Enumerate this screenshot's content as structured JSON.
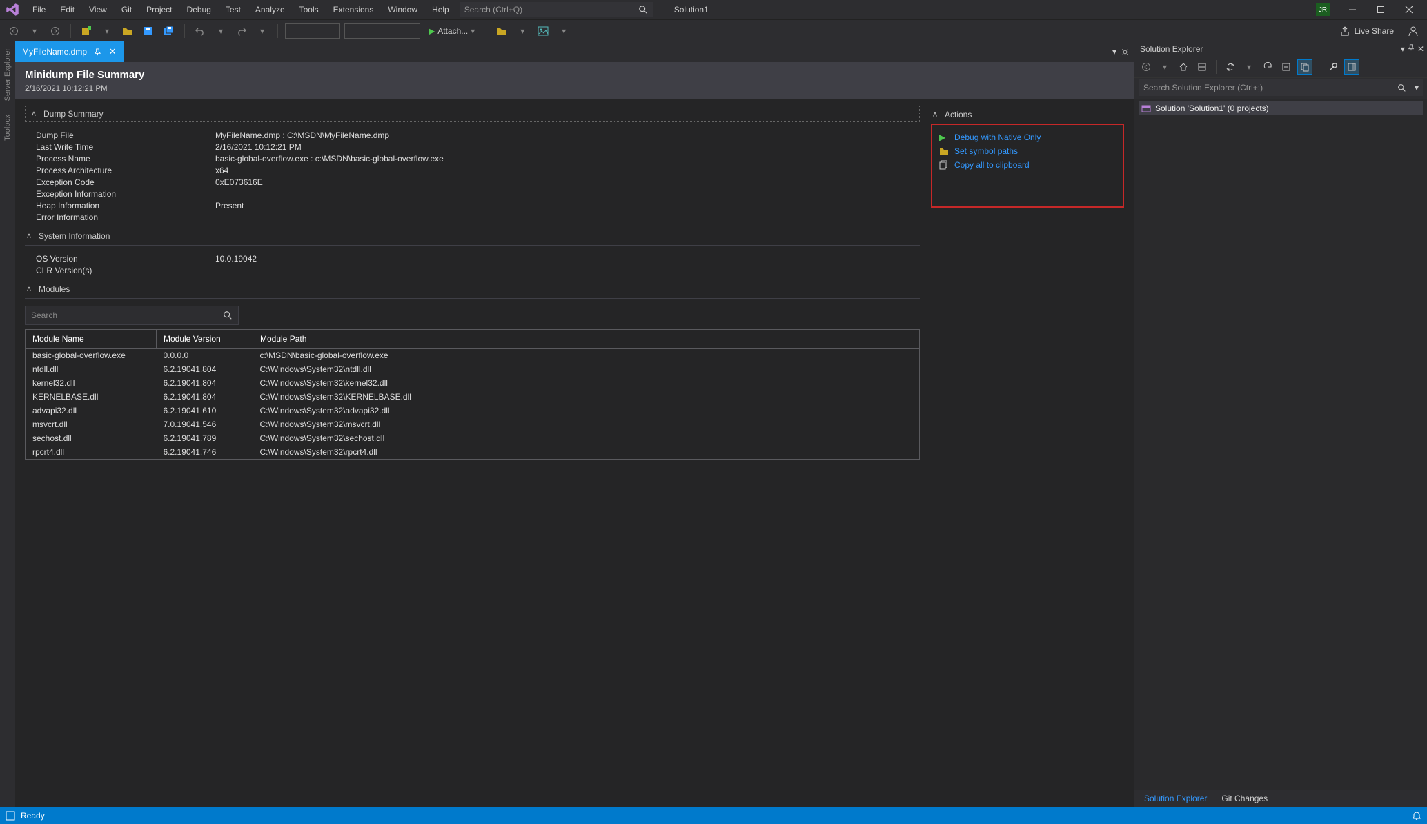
{
  "menubar": {
    "items": [
      "File",
      "Edit",
      "View",
      "Git",
      "Project",
      "Debug",
      "Test",
      "Analyze",
      "Tools",
      "Extensions",
      "Window",
      "Help"
    ],
    "search_placeholder": "Search (Ctrl+Q)",
    "solution_label": "Solution1",
    "user_initials": "JR"
  },
  "toolbar": {
    "attach_label": "Attach...",
    "liveshare_label": "Live Share"
  },
  "leftrail": {
    "tabs": [
      "Server Explorer",
      "Toolbox"
    ]
  },
  "document": {
    "tab_name": "MyFileName.dmp",
    "title": "Minidump File Summary",
    "timestamp": "2/16/2021 10:12:21 PM",
    "sections": {
      "dump_summary": {
        "header": "Dump Summary",
        "rows": [
          {
            "k": "Dump File",
            "v": "MyFileName.dmp : C:\\MSDN\\MyFileName.dmp"
          },
          {
            "k": "Last Write Time",
            "v": "2/16/2021 10:12:21 PM"
          },
          {
            "k": "Process Name",
            "v": "basic-global-overflow.exe : c:\\MSDN\\basic-global-overflow.exe"
          },
          {
            "k": "Process Architecture",
            "v": "x64"
          },
          {
            "k": "Exception Code",
            "v": "0xE073616E"
          },
          {
            "k": "Exception Information",
            "v": ""
          },
          {
            "k": "Heap Information",
            "v": "Present"
          },
          {
            "k": "Error Information",
            "v": ""
          }
        ]
      },
      "system_information": {
        "header": "System Information",
        "rows": [
          {
            "k": "OS Version",
            "v": "10.0.19042"
          },
          {
            "k": "CLR Version(s)",
            "v": ""
          }
        ]
      },
      "modules": {
        "header": "Modules",
        "search_placeholder": "Search",
        "columns": [
          "Module Name",
          "Module Version",
          "Module Path"
        ],
        "rows": [
          {
            "name": "basic-global-overflow.exe",
            "ver": "0.0.0.0",
            "path": "c:\\MSDN\\basic-global-overflow.exe"
          },
          {
            "name": "ntdll.dll",
            "ver": "6.2.19041.804",
            "path": "C:\\Windows\\System32\\ntdll.dll"
          },
          {
            "name": "kernel32.dll",
            "ver": "6.2.19041.804",
            "path": "C:\\Windows\\System32\\kernel32.dll"
          },
          {
            "name": "KERNELBASE.dll",
            "ver": "6.2.19041.804",
            "path": "C:\\Windows\\System32\\KERNELBASE.dll"
          },
          {
            "name": "advapi32.dll",
            "ver": "6.2.19041.610",
            "path": "C:\\Windows\\System32\\advapi32.dll"
          },
          {
            "name": "msvcrt.dll",
            "ver": "7.0.19041.546",
            "path": "C:\\Windows\\System32\\msvcrt.dll"
          },
          {
            "name": "sechost.dll",
            "ver": "6.2.19041.789",
            "path": "C:\\Windows\\System32\\sechost.dll"
          },
          {
            "name": "rpcrt4.dll",
            "ver": "6.2.19041.746",
            "path": "C:\\Windows\\System32\\rpcrt4.dll"
          }
        ]
      }
    },
    "actions": {
      "header": "Actions",
      "items": [
        {
          "icon": "play",
          "label": "Debug with Native Only"
        },
        {
          "icon": "folder",
          "label": "Set symbol paths"
        },
        {
          "icon": "copy",
          "label": "Copy all to clipboard"
        }
      ]
    }
  },
  "solution_explorer": {
    "title": "Solution Explorer",
    "search_placeholder": "Search Solution Explorer (Ctrl+;)",
    "root_label": "Solution 'Solution1' (0 projects)",
    "bottom_tabs": {
      "active": "Solution Explorer",
      "inactive": "Git Changes"
    }
  },
  "statusbar": {
    "ready_label": "Ready"
  }
}
